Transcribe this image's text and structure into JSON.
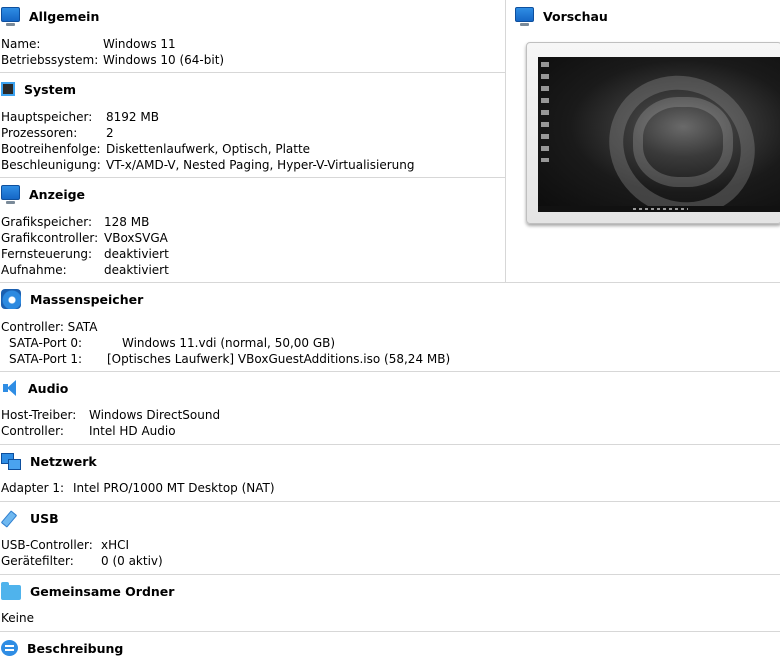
{
  "general": {
    "title": "Allgemein",
    "rows": [
      {
        "label": "Name:",
        "value": "Windows 11"
      },
      {
        "label": "Betriebssystem:",
        "value": "Windows 10 (64-bit)"
      }
    ]
  },
  "preview": {
    "title": "Vorschau"
  },
  "system": {
    "title": "System",
    "rows": [
      {
        "label": "Hauptspeicher:",
        "value": "8192 MB"
      },
      {
        "label": "Prozessoren:",
        "value": "2"
      },
      {
        "label": "Bootreihenfolge:",
        "value": "Diskettenlaufwerk, Optisch, Platte"
      },
      {
        "label": "Beschleunigung:",
        "value": "VT-x/AMD-V, Nested Paging, Hyper-V-Virtualisierung"
      }
    ]
  },
  "display": {
    "title": "Anzeige",
    "rows": [
      {
        "label": "Grafikspeicher:",
        "value": "128 MB"
      },
      {
        "label": "Grafikcontroller:",
        "value": "VBoxSVGA"
      },
      {
        "label": "Fernsteuerung:",
        "value": "deaktiviert"
      },
      {
        "label": "Aufnahme:",
        "value": "deaktiviert"
      }
    ]
  },
  "storage": {
    "title": "Massenspeicher",
    "controller": "Controller: SATA",
    "rows": [
      {
        "label": "SATA-Port 0:",
        "value": "Windows 11.vdi (normal, 50,00 GB)"
      },
      {
        "label": "SATA-Port 1:",
        "value": "[Optisches Laufwerk] VBoxGuestAdditions.iso (58,24 MB)"
      }
    ]
  },
  "audio": {
    "title": "Audio",
    "rows": [
      {
        "label": "Host-Treiber:",
        "value": "Windows DirectSound"
      },
      {
        "label": "Controller:",
        "value": "Intel HD Audio"
      }
    ]
  },
  "network": {
    "title": "Netzwerk",
    "rows": [
      {
        "label": "Adapter 1:",
        "value": "Intel PRO/1000 MT Desktop (NAT)"
      }
    ]
  },
  "usb": {
    "title": "USB",
    "rows": [
      {
        "label": "USB-Controller:",
        "value": "xHCI"
      },
      {
        "label": "Gerätefilter:",
        "value": "0 (0 aktiv)"
      }
    ]
  },
  "shared_folders": {
    "title": "Gemeinsame Ordner",
    "value": "Keine"
  },
  "description": {
    "title": "Beschreibung"
  },
  "icons": {
    "general": "monitor-icon",
    "preview": "monitor-icon",
    "system": "chip-icon",
    "display": "monitor-icon",
    "storage": "disk-icon",
    "audio": "speaker-icon",
    "network": "network-icon",
    "usb": "usb-icon",
    "shared_folders": "folder-icon",
    "description": "speech-bubble-icon"
  }
}
